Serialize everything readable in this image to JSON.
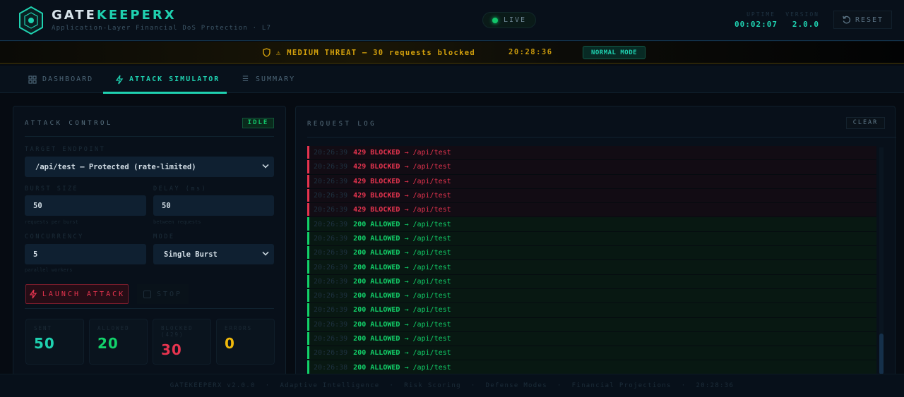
{
  "header": {
    "brand_part1": "GATE",
    "brand_part2": "KEEPERX",
    "tagline": "Application-Layer Financial DoS Protection · L7",
    "live": "LIVE",
    "uptime_label": "UPTIME",
    "uptime": "00:02:07",
    "version_label": "VERSION",
    "version": "2.0.0",
    "reset": "RESET"
  },
  "threat": {
    "message": "⚠ MEDIUM THREAT — 30 requests blocked",
    "time": "20:28:36",
    "mode": "NORMAL MODE"
  },
  "tabs": [
    {
      "label": "DASHBOARD"
    },
    {
      "label": "ATTACK SIMULATOR"
    },
    {
      "label": "SUMMARY"
    }
  ],
  "control": {
    "title": "ATTACK CONTROL",
    "status": "IDLE",
    "target_label": "TARGET ENDPOINT",
    "target_value": "/api/test — Protected (rate-limited)",
    "burst_label": "BURST SIZE",
    "burst_value": "50",
    "burst_hint": "requests per burst",
    "delay_label": "DELAY (ms)",
    "delay_value": "50",
    "delay_hint": "between requests",
    "concurrency_label": "CONCURRENCY",
    "concurrency_value": "5",
    "concurrency_hint": "parallel workers",
    "mode_label": "MODE",
    "mode_value": "Single Burst",
    "launch": "LAUNCH ATTACK",
    "stop": "STOP",
    "stats": [
      {
        "label": "SENT",
        "value": "50",
        "color": "#1fd1b0"
      },
      {
        "label": "ALLOWED",
        "value": "20",
        "color": "#12d26a"
      },
      {
        "label": "BLOCKED (429)",
        "value": "30",
        "color": "#e6344f"
      },
      {
        "label": "ERRORS",
        "value": "0",
        "color": "#f0b90b"
      }
    ]
  },
  "log": {
    "title": "REQUEST LOG",
    "clear": "CLEAR",
    "entries": [
      {
        "time": "20:26:39",
        "status": "429 BLOCKED",
        "path": "→ /api/test",
        "type": "blocked"
      },
      {
        "time": "20:26:39",
        "status": "429 BLOCKED",
        "path": "→ /api/test",
        "type": "blocked"
      },
      {
        "time": "20:26:39",
        "status": "429 BLOCKED",
        "path": "→ /api/test",
        "type": "blocked"
      },
      {
        "time": "20:26:39",
        "status": "429 BLOCKED",
        "path": "→ /api/test",
        "type": "blocked"
      },
      {
        "time": "20:26:39",
        "status": "429 BLOCKED",
        "path": "→ /api/test",
        "type": "blocked"
      },
      {
        "time": "20:26:39",
        "status": "200 ALLOWED",
        "path": "→ /api/test",
        "type": "allowed"
      },
      {
        "time": "20:26:39",
        "status": "200 ALLOWED",
        "path": "→ /api/test",
        "type": "allowed"
      },
      {
        "time": "20:26:39",
        "status": "200 ALLOWED",
        "path": "→ /api/test",
        "type": "allowed"
      },
      {
        "time": "20:26:39",
        "status": "200 ALLOWED",
        "path": "→ /api/test",
        "type": "allowed"
      },
      {
        "time": "20:26:39",
        "status": "200 ALLOWED",
        "path": "→ /api/test",
        "type": "allowed"
      },
      {
        "time": "20:26:39",
        "status": "200 ALLOWED",
        "path": "→ /api/test",
        "type": "allowed"
      },
      {
        "time": "20:26:39",
        "status": "200 ALLOWED",
        "path": "→ /api/test",
        "type": "allowed"
      },
      {
        "time": "20:26:39",
        "status": "200 ALLOWED",
        "path": "→ /api/test",
        "type": "allowed"
      },
      {
        "time": "20:26:39",
        "status": "200 ALLOWED",
        "path": "→ /api/test",
        "type": "allowed"
      },
      {
        "time": "20:26:39",
        "status": "200 ALLOWED",
        "path": "→ /api/test",
        "type": "allowed"
      },
      {
        "time": "20:26:38",
        "status": "200 ALLOWED",
        "path": "→ /api/test",
        "type": "allowed"
      }
    ]
  },
  "footer": {
    "items": [
      "GATEKEEPERX v2.0.0",
      "·",
      "Adaptive Intelligence",
      "·",
      "Risk Scoring",
      "·",
      "Defense Modes",
      "·",
      "Financial Projections",
      "·",
      "20:28:36"
    ]
  }
}
